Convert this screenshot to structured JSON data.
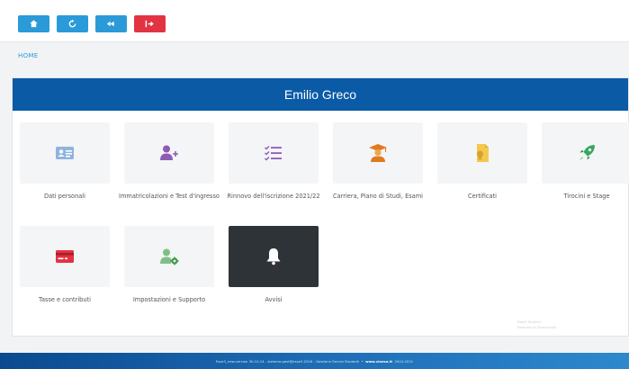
{
  "toolbar": {
    "home_icon": "home-icon",
    "refresh_icon": "refresh-icon",
    "back_icon": "back-icon",
    "logout_icon": "logout-icon",
    "colors": {
      "primary": "#2b9ad8",
      "danger": "#e23343"
    }
  },
  "breadcrumb": {
    "home_label": "HOME"
  },
  "header": {
    "user_name": "Emilio Greco",
    "color": "#0a5aa6"
  },
  "menu": {
    "items": [
      {
        "label": "Dati personali",
        "icon": "id-card-icon"
      },
      {
        "label": "Immatricolazioni e Test d'ingresso",
        "icon": "user-add-icon"
      },
      {
        "label": "Rinnovo dell'iscrizione 2021/22",
        "icon": "checklist-icon"
      },
      {
        "label": "Carriera, Piano di Studi, Esami",
        "icon": "graduate-icon"
      },
      {
        "label": "Certificati",
        "icon": "certificate-icon"
      },
      {
        "label": "Tirocini e Stage",
        "icon": "rocket-icon"
      },
      {
        "label": "Tasse e contributi",
        "icon": "credit-card-icon"
      },
      {
        "label": "Impostazioni e Supporto",
        "icon": "user-settings-icon"
      },
      {
        "label": "Avvisi",
        "icon": "bell-icon"
      }
    ]
  },
  "watermark": {
    "line1": "Esse3 Studenti",
    "line2": "Powered by ZeroGravity"
  },
  "footer": {
    "info": "Esse3_new.version 30.10.14 - sistema.gest@esse3.2016 - Gestione Servizi Studenti",
    "brand": "www.cineca.it",
    "years": "2004-2021"
  }
}
